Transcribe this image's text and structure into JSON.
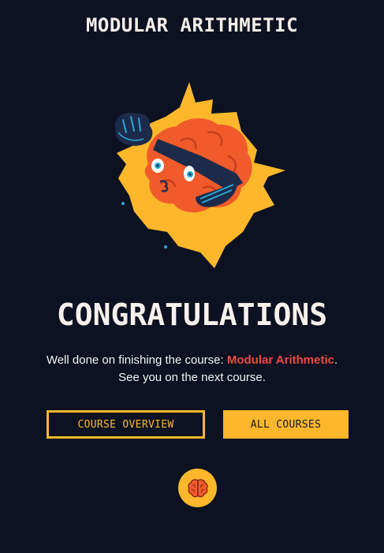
{
  "header": {
    "title": "MODULAR ARITHMETIC"
  },
  "hero": {
    "illustration": "exploding-brain-with-fork-illustration"
  },
  "completion": {
    "heading": "CONGRATULATIONS",
    "message_prefix": "Well done on finishing the course: ",
    "course_name": "Modular Arithmetic",
    "message_suffix": ".",
    "message_line2": "See you on the next course."
  },
  "actions": {
    "course_overview_label": "COURSE OVERVIEW",
    "all_courses_label": "ALL COURSES"
  },
  "footer": {
    "logo_icon": "brain-icon"
  },
  "colors": {
    "background": "#0c1222",
    "accent": "#fdb72b",
    "highlight": "#ef4a3e",
    "brain": "#f15a2b"
  }
}
